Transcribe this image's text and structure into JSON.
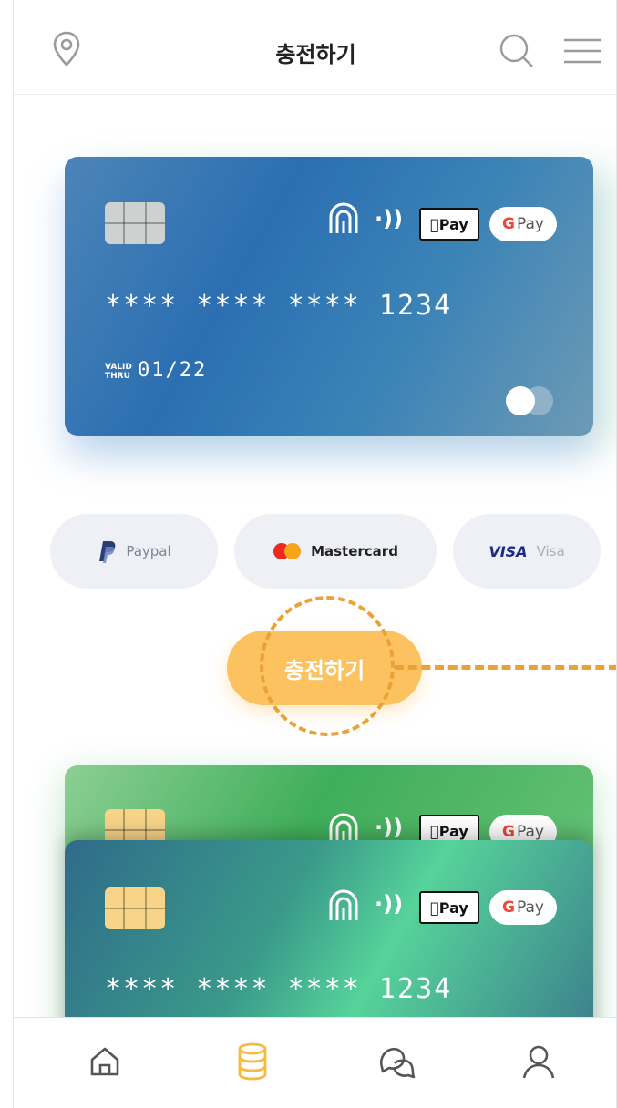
{
  "header": {
    "title": "충전하기",
    "left_icon": "location-pin-icon",
    "right_icons": [
      "search-icon",
      "menu-icon"
    ]
  },
  "cards": [
    {
      "number": "**** **** **** 1234",
      "valid_label": "VALID\nTHRU",
      "valid": "01/22",
      "applepay": "Pay",
      "gpay_g": "G",
      "gpay": "Pay",
      "color": "#3f7fb9"
    },
    {
      "applepay": "Pay",
      "gpay_g": "G",
      "gpay": "Pay",
      "color": "#4fb865"
    },
    {
      "number": "**** **** **** 1234",
      "applepay": "Pay",
      "gpay_g": "G",
      "gpay": "Pay",
      "color": "#3a9a8a"
    }
  ],
  "payment_methods": [
    {
      "label": "Paypal",
      "icon": "paypal-icon"
    },
    {
      "label": "Mastercard",
      "icon": "mastercard-icon"
    },
    {
      "label": "Visa",
      "mark": "VISA",
      "icon": "visa-icon"
    }
  ],
  "charge_button": {
    "label": "충전하기",
    "color": "#fcc25f"
  },
  "bottom_nav": [
    {
      "icon": "home-icon",
      "active": false
    },
    {
      "icon": "database-icon",
      "active": true
    },
    {
      "icon": "chat-icon",
      "active": false
    },
    {
      "icon": "user-icon",
      "active": false
    }
  ],
  "colors": {
    "accent": "#f7b93f",
    "annotation": "#e9a238"
  }
}
